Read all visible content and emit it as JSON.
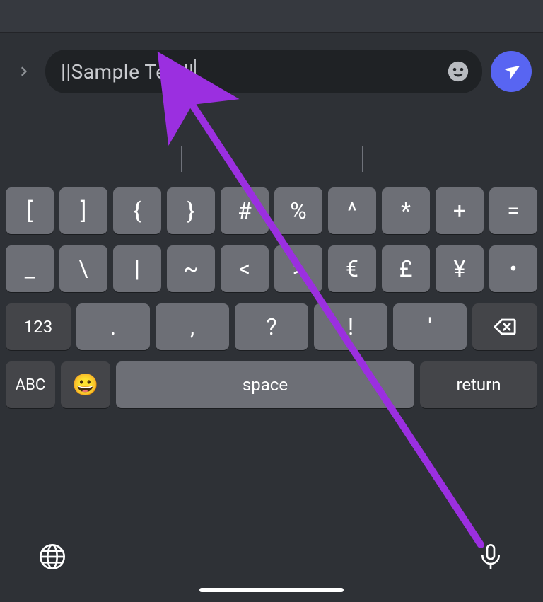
{
  "input": {
    "text": "||Sample Text||"
  },
  "keyboard": {
    "row1": [
      "[",
      "]",
      "{",
      "}",
      "#",
      "%",
      "^",
      "*",
      "+",
      "="
    ],
    "row2": [
      "_",
      "\\",
      "|",
      "~",
      "<",
      ">",
      "€",
      "£",
      "¥",
      "•"
    ],
    "row3": {
      "numToggle": "123",
      "punct": [
        ".",
        ",",
        "?",
        "!",
        "'"
      ]
    },
    "row4": {
      "abc": "ABC",
      "emoji": "😀",
      "space": "space",
      "ret": "return"
    }
  },
  "annotation": {
    "color": "#9b2fe0"
  }
}
